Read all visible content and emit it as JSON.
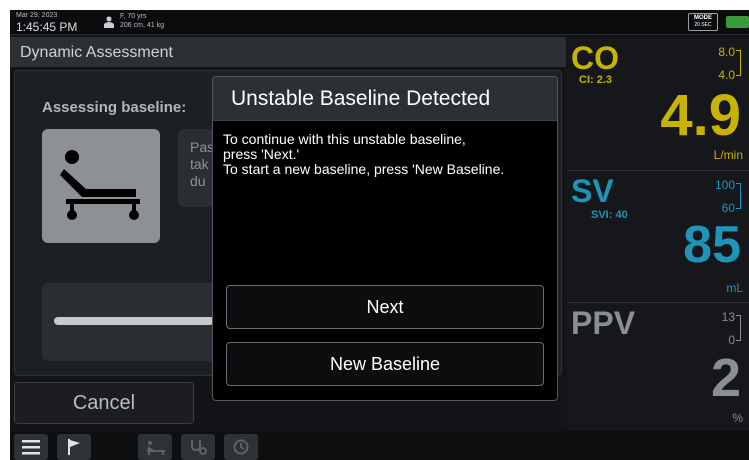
{
  "status_bar": {
    "date": "Mar 29, 2023",
    "time": "1:45:45 PM",
    "patient_line1": "F, 70 yrs",
    "patient_line2": "206 cm, 41 kg",
    "mode_label": "MODE",
    "mode_value": "20 SEC",
    "icons": [
      "patient-icon",
      "battery-icon"
    ]
  },
  "panel": {
    "title": "Dynamic Assessment",
    "assessing_label": "Assessing baseline:",
    "instruction_fragment": "Pas\ntak\ndu",
    "cancel_label": "Cancel"
  },
  "modal": {
    "title": "Unstable Baseline Detected",
    "line1": "To continue with this unstable baseline,",
    "line2": "press 'Next.'",
    "line3": "To start a new baseline, press 'New Baseline.",
    "next_label": "Next",
    "new_baseline_label": "New Baseline"
  },
  "parameters": {
    "co": {
      "name": "CO",
      "sub": "CI: 2.3",
      "hi": "8.0",
      "lo": "4.0",
      "value": "4.9",
      "unit": "L/min",
      "color": "#c8b400"
    },
    "sv": {
      "name": "SV",
      "sub": "SVI: 40",
      "hi": "100",
      "lo": "60",
      "value": "85",
      "unit": "mL",
      "color": "#1e95b8"
    },
    "ppv": {
      "name": "PPV",
      "hi": "13",
      "lo": "0",
      "value": "2",
      "unit": "%",
      "color": "#8a8d91"
    }
  },
  "nav": {
    "icons": [
      "menu-icon",
      "flag-icon",
      "patient-bed-icon",
      "stethoscope-icon",
      "history-icon"
    ]
  },
  "colors": {
    "background": "#121417",
    "modal": "#000000",
    "co_accent": "#c8b400",
    "sv_accent": "#1e95b8"
  }
}
